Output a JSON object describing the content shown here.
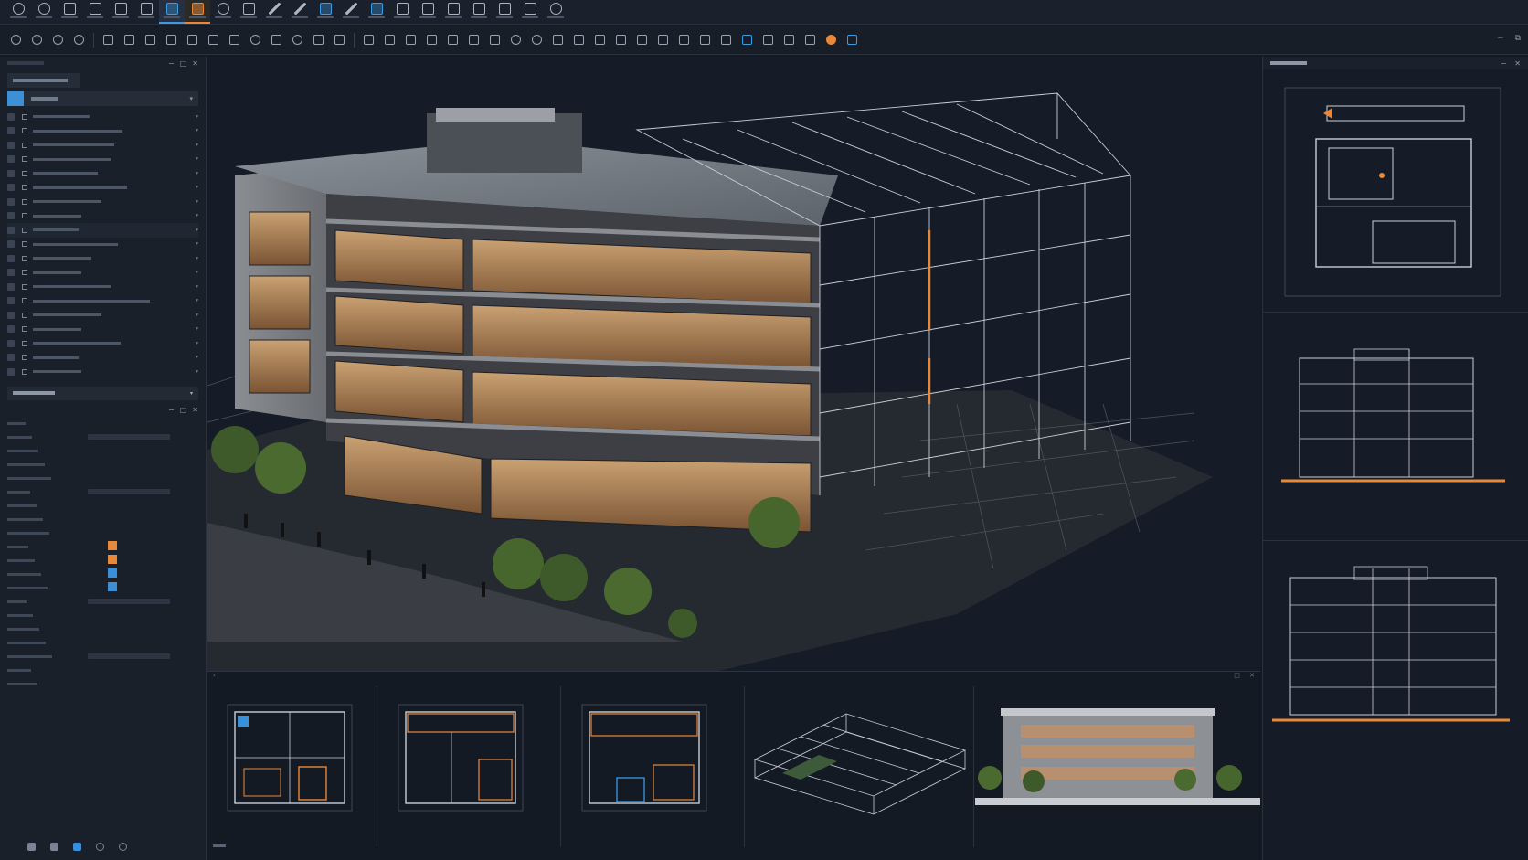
{
  "ribbon": {
    "tools": [
      {
        "icon": "settings-icon",
        "style": "circle"
      },
      {
        "icon": "refresh-icon",
        "style": "circle"
      },
      {
        "icon": "folder-icon",
        "style": "plain"
      },
      {
        "icon": "layer-icon",
        "style": "plain"
      },
      {
        "icon": "stack-icon",
        "style": "plain"
      },
      {
        "icon": "grid-icon",
        "style": "plain"
      },
      {
        "icon": "view-icon",
        "style": "blue",
        "active": true
      },
      {
        "icon": "model-icon",
        "style": "orange",
        "active": true
      },
      {
        "icon": "annotate-icon",
        "style": "circle"
      },
      {
        "icon": "edit-icon",
        "style": "plain"
      },
      {
        "icon": "draw-icon",
        "style": "diag"
      },
      {
        "icon": "sketch-icon",
        "style": "diag"
      },
      {
        "icon": "section-icon",
        "style": "blue"
      },
      {
        "icon": "pen-icon",
        "style": "diag"
      },
      {
        "icon": "image-icon",
        "style": "blue"
      },
      {
        "icon": "sheet-icon",
        "style": "plain"
      },
      {
        "icon": "render-icon",
        "style": "plain"
      },
      {
        "icon": "schedule-icon",
        "style": "plain"
      },
      {
        "icon": "analyze-icon",
        "style": "plain"
      },
      {
        "icon": "export-icon",
        "style": "plain"
      },
      {
        "icon": "layout-icon",
        "style": "plain"
      },
      {
        "icon": "sync-icon",
        "style": "circle"
      }
    ]
  },
  "toolbar": {
    "tools": [
      "circle",
      "circle",
      "circle",
      "circle",
      "sep",
      "plain",
      "plain",
      "plain",
      "plain",
      "plain",
      "plain",
      "plain",
      "circle",
      "plain",
      "circle",
      "plain",
      "plain",
      "sep",
      "plain",
      "plain",
      "plain",
      "plain",
      "plain",
      "plain",
      "plain",
      "circle",
      "circle",
      "plain",
      "plain",
      "plain",
      "plain",
      "plain",
      "plain",
      "plain",
      "plain",
      "plain",
      "blue",
      "plain",
      "plain",
      "plain",
      "orange",
      "blue"
    ]
  },
  "colors": {
    "accent_blue": "#3d9be0",
    "accent_orange": "#e8883a",
    "background": "#141a24",
    "panel": "#1a2029"
  },
  "tree": {
    "rows": [
      {
        "w": 0.35
      },
      {
        "w": 0.55
      },
      {
        "w": 0.5
      },
      {
        "w": 0.48
      },
      {
        "w": 0.4
      },
      {
        "w": 0.58
      },
      {
        "w": 0.42
      },
      {
        "w": 0.3
      },
      {
        "w": 0.28,
        "selected": true
      },
      {
        "w": 0.52
      },
      {
        "w": 0.36
      },
      {
        "w": 0.3
      },
      {
        "w": 0.48
      },
      {
        "w": 0.72
      },
      {
        "w": 0.42
      },
      {
        "w": 0.3
      },
      {
        "w": 0.54
      },
      {
        "w": 0.28
      },
      {
        "w": 0.3
      }
    ]
  },
  "properties": {
    "swatches": [
      "#e8883a",
      "#e8883a",
      "#3a8fd6",
      "#3a8fd6"
    ]
  }
}
